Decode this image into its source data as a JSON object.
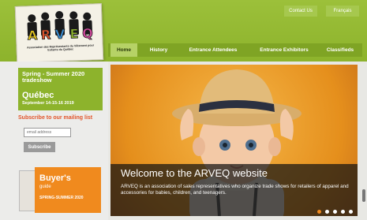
{
  "logo": {
    "wordmark": "ARVEQ",
    "tagline": "Association des Représentants du Vêtement pour Enfants du Québec"
  },
  "utility_links": [
    "Contact Us",
    "Français"
  ],
  "nav": [
    {
      "label": "Home",
      "active": true
    },
    {
      "label": "History"
    },
    {
      "label": "Entrance Attendees"
    },
    {
      "label": "Entrance Exhibitors"
    },
    {
      "label": "Classifieds"
    }
  ],
  "event": {
    "season": "Spring - Summer 2020 tradeshow",
    "city": "Québec",
    "dates": "September 14-15-16 2019"
  },
  "subscribe": {
    "title": "Subscribe to our mailing list",
    "email_placeholder": "email address",
    "button": "Subscribe"
  },
  "guide": {
    "title": "Buyer's",
    "subtitle": "guide",
    "season": "SPRING-SUMMER 2020"
  },
  "hero": {
    "title": "Welcome to the ARVEQ website",
    "text": "ARVEQ is an association of sales representatives who organize trade shows for retailers of apparel and accessories for babies, children, and teenagers.",
    "slide_count": 5,
    "active_slide": 1
  },
  "colors": {
    "brand_green": "#8db32c",
    "accent_orange": "#f08a1e",
    "subscribe_red": "#e2552c"
  }
}
